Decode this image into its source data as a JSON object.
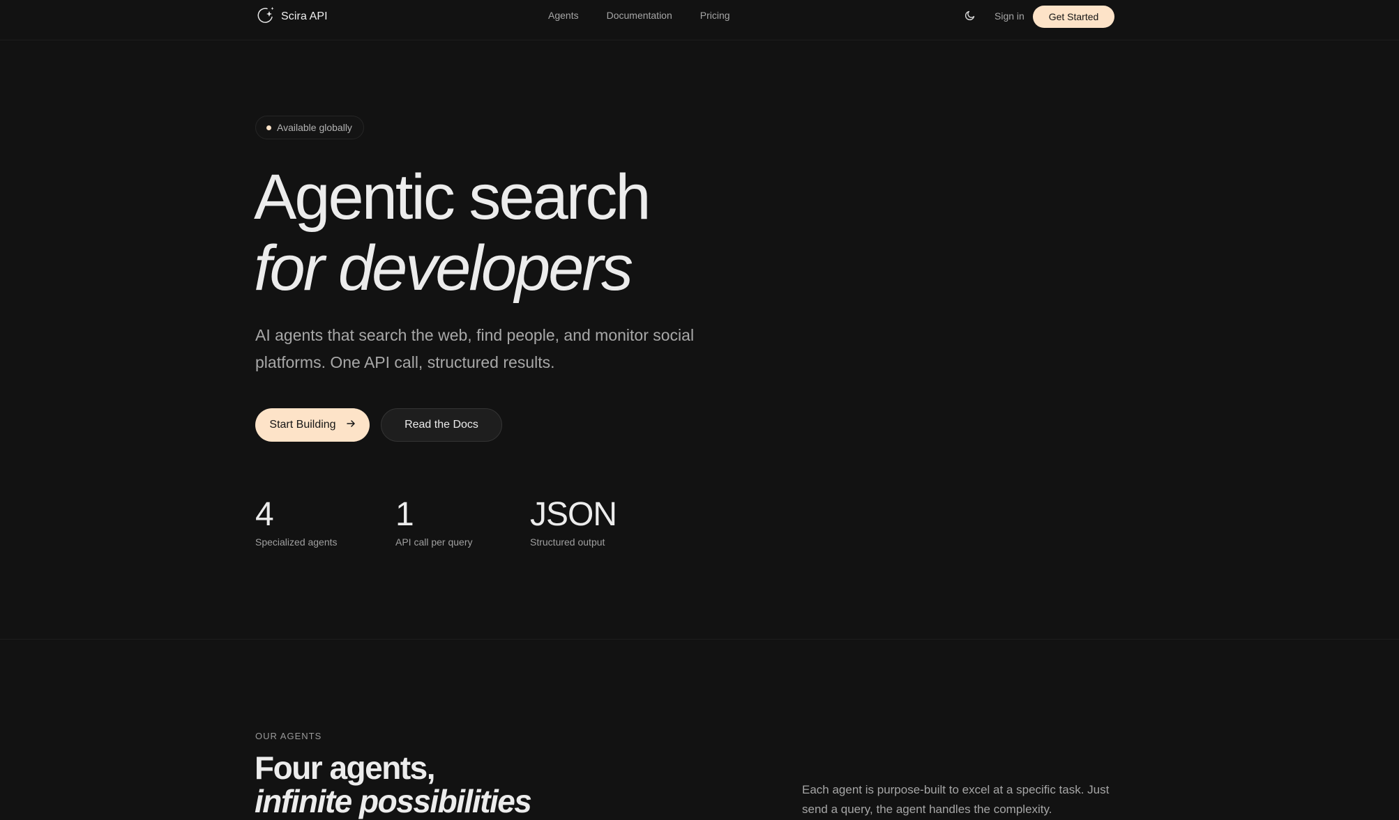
{
  "nav": {
    "brand": "Scira API",
    "links": [
      {
        "label": "Agents"
      },
      {
        "label": "Documentation"
      },
      {
        "label": "Pricing"
      }
    ],
    "sign_in": "Sign in",
    "get_started": "Get Started"
  },
  "hero": {
    "badge": "Available globally",
    "title_line1": "Agentic search",
    "title_line2": "for developers",
    "subtitle": "AI agents that search the web, find people, and monitor social platforms. One API call, structured results.",
    "primary_cta": "Start Building",
    "secondary_cta": "Read the Docs",
    "stats": [
      {
        "value": "4",
        "label": "Specialized agents"
      },
      {
        "value": "1",
        "label": "API call per query"
      },
      {
        "value": "JSON",
        "label": "Structured output"
      }
    ]
  },
  "agents_section": {
    "eyebrow": "OUR AGENTS",
    "title_line1": "Four agents,",
    "title_line2": "infinite possibilities",
    "description": "Each agent is purpose-built to excel at a specific task. Just send a query, the agent handles the complexity."
  },
  "colors": {
    "background": "#121212",
    "accent": "#fde3c8",
    "text": "#ececec",
    "muted": "#a6a6a6"
  },
  "icons": {
    "logo": "sparkle-moon-icon",
    "theme": "moon-icon",
    "cta_arrow": "arrow-right-icon"
  }
}
